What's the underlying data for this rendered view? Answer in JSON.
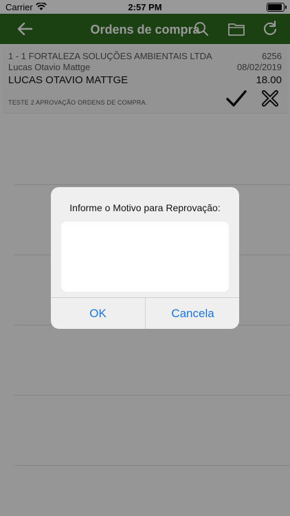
{
  "status_bar": {
    "carrier": "Carrier",
    "time": "2:57 PM"
  },
  "nav": {
    "title": "Ordens de compra",
    "icons": [
      "back-arrow-icon",
      "search-icon",
      "folder-icon",
      "refresh-icon"
    ],
    "bg_color": "#2e6b1f"
  },
  "orders": [
    {
      "company": "1 - 1 FORTALEZA SOLUÇÕES AMBIENTAIS LTDA",
      "number": "6256",
      "requester": "Lucas Otavio Mattge",
      "date": "08/02/2019",
      "approver": "LUCAS OTAVIO MATTGE",
      "amount": "18.00",
      "description": "TESTE 2 APROVAÇÃO ORDENS DE COMPRA."
    }
  ],
  "dialog": {
    "message": "Informe o Motivo para Reprovação:",
    "input_value": "",
    "ok_label": "OK",
    "cancel_label": "Cancela",
    "button_color": "#1a73d9"
  }
}
